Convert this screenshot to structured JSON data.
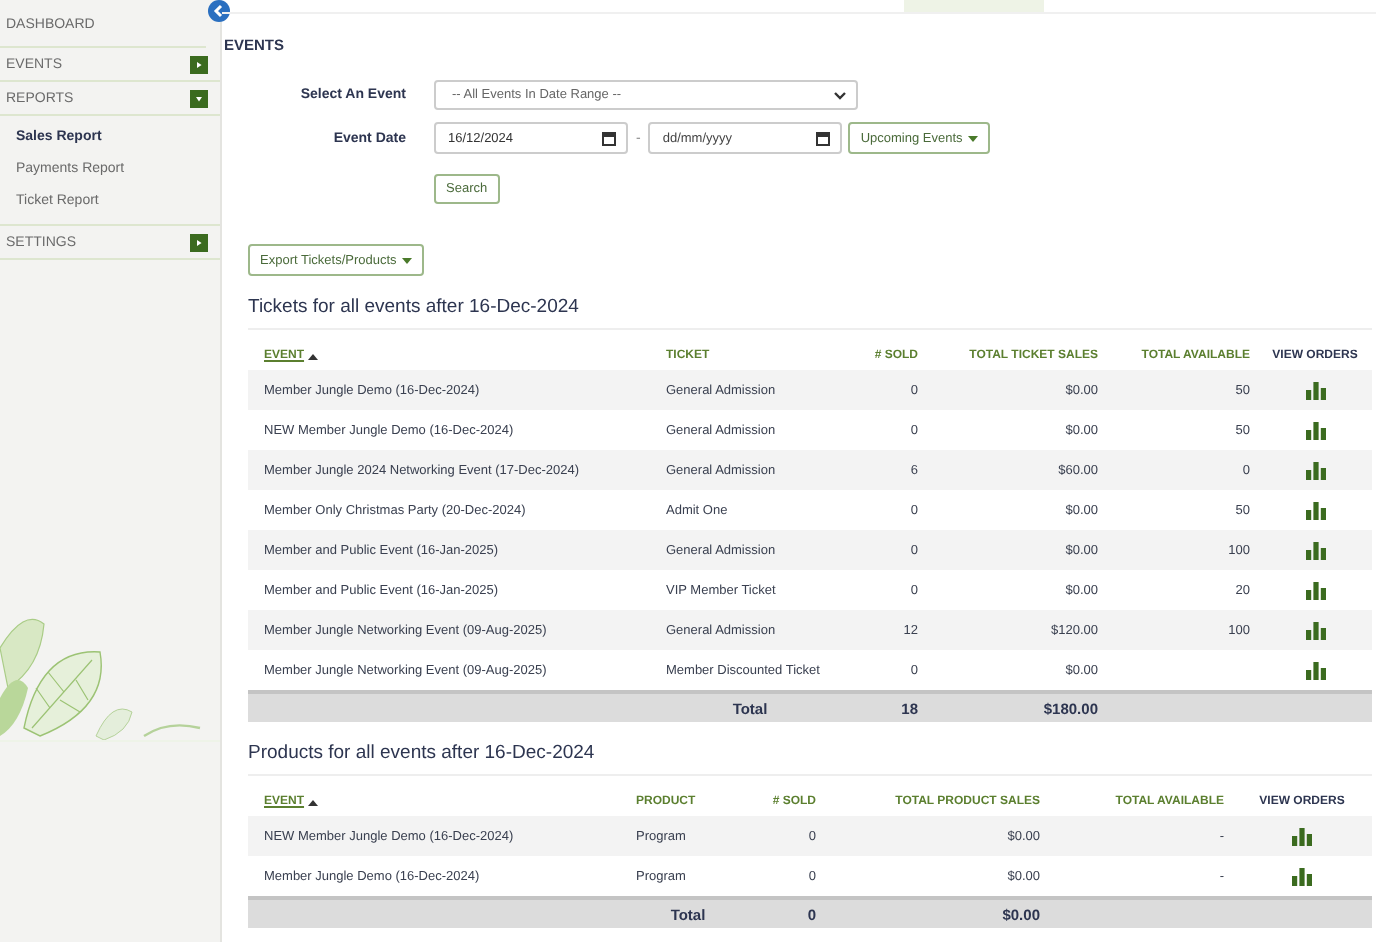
{
  "sidebar": {
    "items": [
      {
        "label": "DASHBOARD",
        "kind": "link"
      },
      {
        "label": "EVENTS",
        "kind": "group",
        "expanded": false
      },
      {
        "label": "REPORTS",
        "kind": "group",
        "expanded": true,
        "children": [
          {
            "label": "Sales Report",
            "selected": true
          },
          {
            "label": "Payments Report",
            "selected": false
          },
          {
            "label": "Ticket Report",
            "selected": false
          }
        ]
      },
      {
        "label": "SETTINGS",
        "kind": "group",
        "expanded": false
      }
    ]
  },
  "page_title": "EVENTS",
  "filters": {
    "event_label": "Select An Event",
    "event_value": "-- All Events In Date Range --",
    "date_label": "Event Date",
    "date_from": "16/12/2024",
    "date_separator": "-",
    "date_to_placeholder": "dd/mm/yyyy",
    "range_button": "Upcoming Events",
    "search_button": "Search"
  },
  "export_button": "Export Tickets/Products",
  "tickets": {
    "heading": "Tickets for all events after 16-Dec-2024",
    "columns": [
      {
        "label": "EVENT",
        "sorted": true
      },
      {
        "label": "TICKET",
        "sorted": false
      },
      {
        "label": "# SOLD",
        "sorted": false
      },
      {
        "label": "TOTAL TICKET SALES",
        "sorted": false
      },
      {
        "label": "TOTAL AVAILABLE",
        "sorted": false
      },
      {
        "label": "VIEW ORDERS",
        "sorted": false
      }
    ],
    "rows": [
      [
        "Member Jungle Demo (16-Dec-2024)",
        "General Admission",
        "0",
        "$0.00",
        "50"
      ],
      [
        "NEW Member Jungle Demo (16-Dec-2024)",
        "General Admission",
        "0",
        "$0.00",
        "50"
      ],
      [
        "Member Jungle 2024 Networking Event (17-Dec-2024)",
        "General Admission",
        "6",
        "$60.00",
        "0"
      ],
      [
        "Member Only Christmas Party (20-Dec-2024)",
        "Admit One",
        "0",
        "$0.00",
        "50"
      ],
      [
        "Member and Public Event (16-Jan-2025)",
        "General Admission",
        "0",
        "$0.00",
        "100"
      ],
      [
        "Member and Public Event (16-Jan-2025)",
        "VIP Member Ticket",
        "0",
        "$0.00",
        "20"
      ],
      [
        "Member Jungle Networking Event (09-Aug-2025)",
        "General Admission",
        "12",
        "$120.00",
        "100"
      ],
      [
        "Member Jungle Networking Event (09-Aug-2025)",
        "Member Discounted Ticket",
        "0",
        "$0.00",
        ""
      ]
    ],
    "total": {
      "label": "Total",
      "sold": "18",
      "sales": "$180.00"
    }
  },
  "products": {
    "heading": "Products for all events after 16-Dec-2024",
    "columns": [
      {
        "label": "EVENT",
        "sorted": true
      },
      {
        "label": "PRODUCT",
        "sorted": false
      },
      {
        "label": "# SOLD",
        "sorted": false
      },
      {
        "label": "TOTAL PRODUCT SALES",
        "sorted": false
      },
      {
        "label": "TOTAL AVAILABLE",
        "sorted": false
      },
      {
        "label": "VIEW ORDERS",
        "sorted": false
      }
    ],
    "rows": [
      [
        "NEW Member Jungle Demo (16-Dec-2024)",
        "Program",
        "0",
        "$0.00",
        "-"
      ],
      [
        "Member Jungle Demo (16-Dec-2024)",
        "Program",
        "0",
        "$0.00",
        "-"
      ]
    ],
    "total": {
      "label": "Total",
      "sold": "0",
      "sales": "$0.00"
    }
  }
}
